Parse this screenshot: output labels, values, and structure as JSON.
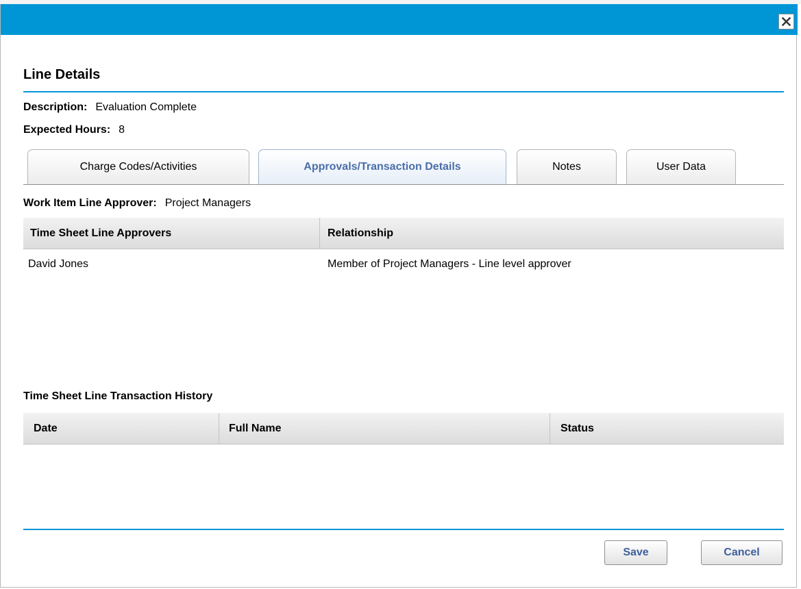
{
  "dialog": {
    "heading": "Line Details",
    "close_label": "×"
  },
  "fields": {
    "description_label": "Description:",
    "description_value": "Evaluation Complete",
    "hours_label": "Expected Hours:",
    "hours_value": "8"
  },
  "tabs": [
    {
      "label": "Charge Codes/Activities",
      "active": false
    },
    {
      "label": "Approvals/Transaction Details",
      "active": true
    },
    {
      "label": "Notes",
      "active": false
    },
    {
      "label": "User Data",
      "active": false
    }
  ],
  "approvals": {
    "work_item_label": "Work Item Line Approver:",
    "work_item_value": "Project Managers",
    "columns": [
      "Time Sheet Line Approvers",
      "Relationship"
    ],
    "rows": [
      [
        "David Jones",
        "Member of Project Managers - Line level approver"
      ]
    ]
  },
  "history": {
    "title": "Time Sheet Line Transaction History",
    "columns": [
      "Date",
      "Full Name",
      "Status"
    ],
    "rows": []
  },
  "buttons": {
    "save": "Save",
    "cancel": "Cancel"
  },
  "colors": {
    "accent": "#0096d6",
    "active_tab_text": "#4a6ea8",
    "button_text": "#3e5f9c"
  },
  "icons": {
    "close": "close-icon"
  }
}
